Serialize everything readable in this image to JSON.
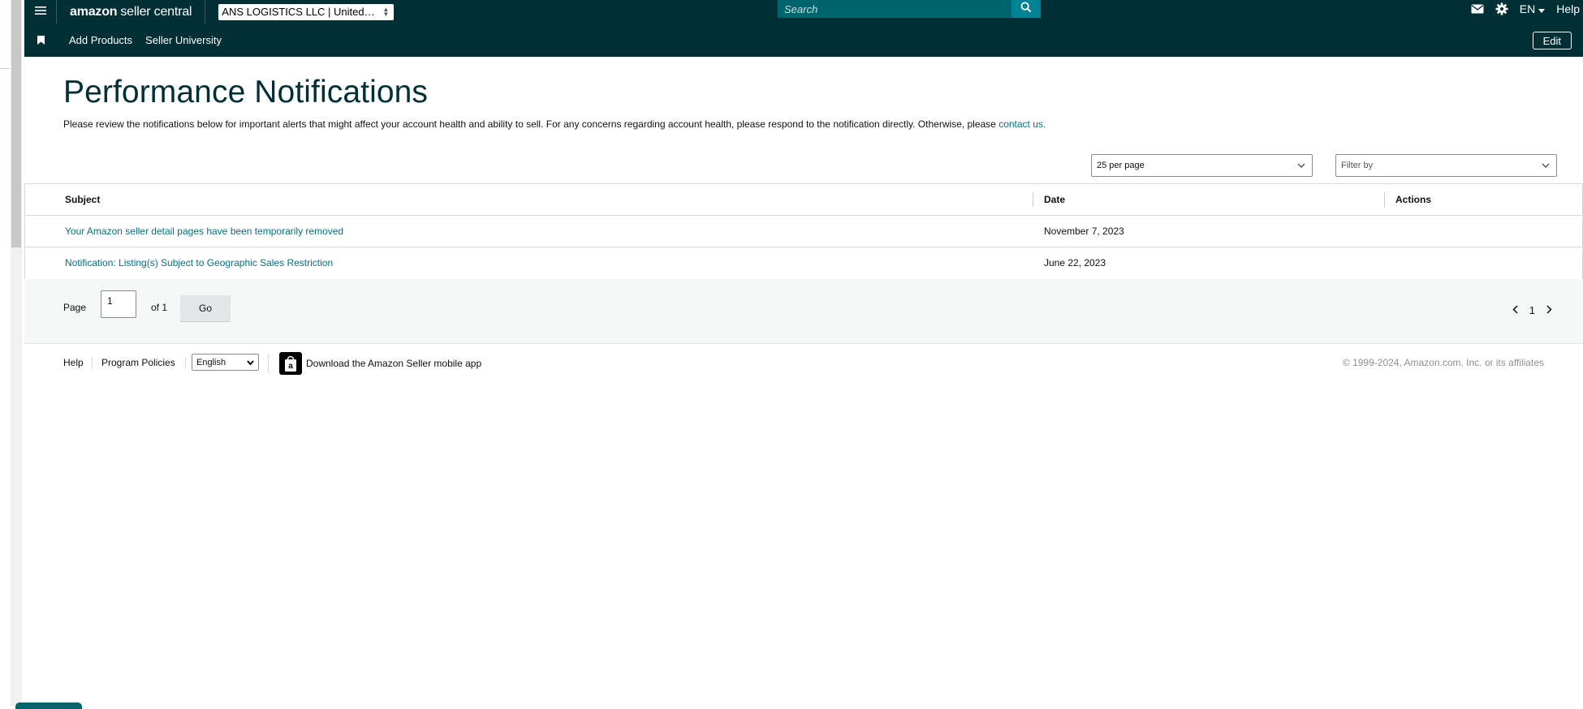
{
  "topbar": {
    "logo_bold": "amazon",
    "logo_rest": "seller central",
    "account": "ANS LOGISTICS LLC | United…",
    "search_placeholder": "Search",
    "language": "EN",
    "help": "Help"
  },
  "subbar": {
    "links": [
      "Add Products",
      "Seller University"
    ],
    "edit": "Edit"
  },
  "page": {
    "title": "Performance Notifications",
    "description": "Please review the notifications below for important alerts that might affect your account health and ability to sell. For any concerns regarding account health, please respond to the notification directly. Otherwise, please ",
    "contact_link": "contact us."
  },
  "controls": {
    "per_page": "25 per page",
    "filter": "Filter by"
  },
  "table": {
    "headers": [
      "Subject",
      "Date",
      "Actions"
    ],
    "rows": [
      {
        "subject": "Your Amazon seller detail pages have been temporarily removed",
        "date": "November 7, 2023"
      },
      {
        "subject": "Notification: Listing(s) Subject to Geographic Sales Restriction",
        "date": "June 22, 2023"
      }
    ]
  },
  "pager": {
    "page_label": "Page",
    "current": "1",
    "of_label": "of 1",
    "go": "Go",
    "nav_page": "1"
  },
  "footer": {
    "help": "Help",
    "policies": "Program Policies",
    "language": "English",
    "app": "Download the Amazon Seller mobile app",
    "copyright": "© 1999-2024, Amazon.com, Inc. or its affiliates"
  },
  "colors": {
    "nav_bg": "#002f36",
    "search_bg": "#00646c",
    "search_btn": "#008296",
    "link": "#007185",
    "title": "#002f36"
  },
  "icons": [
    "hamburger-icon",
    "search-icon",
    "mail-icon",
    "gear-icon",
    "caret-down-icon",
    "bookmark-icon",
    "chevron-down-icon",
    "chevron-left-icon",
    "chevron-right-icon",
    "amazon-app-icon"
  ]
}
